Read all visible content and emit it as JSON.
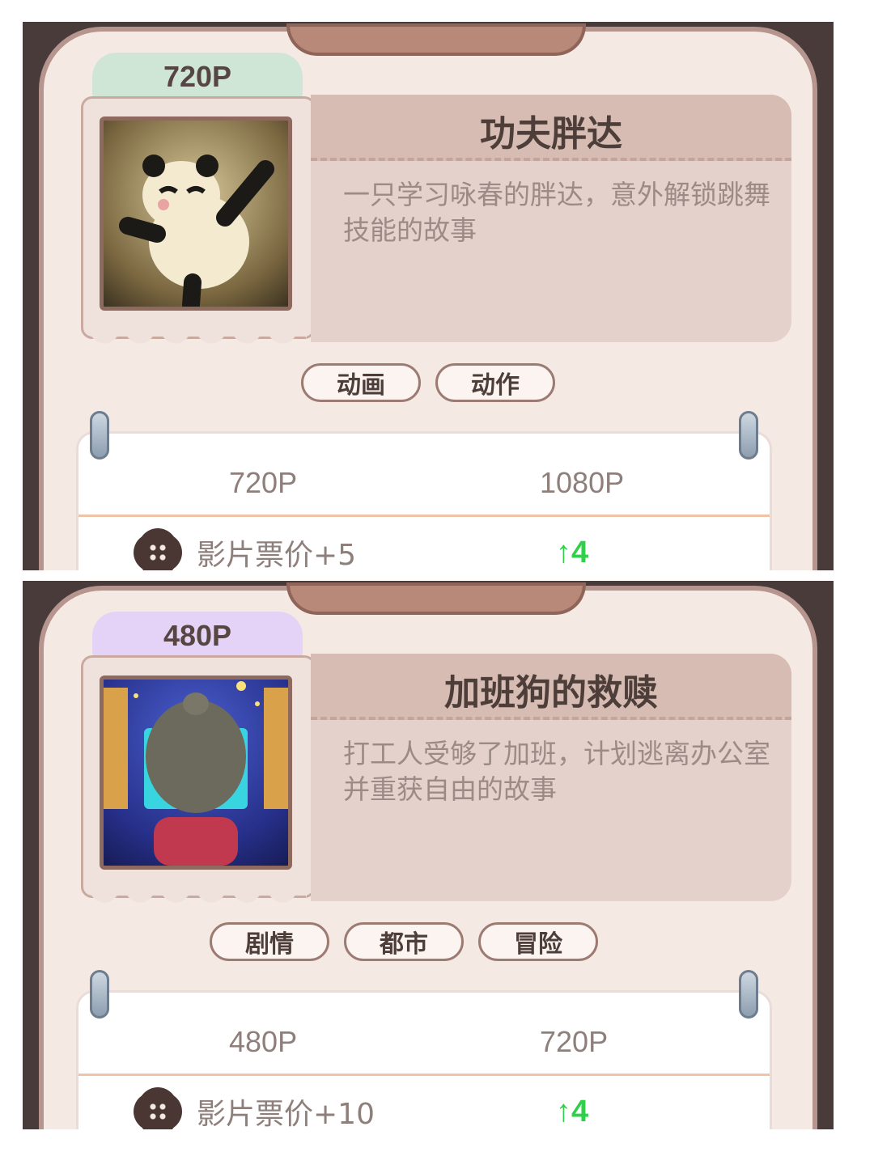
{
  "panels": [
    {
      "quality": "720P",
      "title": "功夫胖达",
      "description": "一只学习咏春的胖达，意外解锁跳舞技能的故事",
      "poster_icon": "panda-poster",
      "tags": [
        "动画",
        "动作"
      ],
      "stats": {
        "from": "720P",
        "to": "1080P",
        "rows": [
          {
            "icon": "ticket-gear-icon",
            "label": "影片票价+5",
            "change": "↑4"
          }
        ]
      }
    },
    {
      "quality": "480P",
      "title": "加班狗的救赎",
      "description": "打工人受够了加班，计划逃离办公室并重获自由的故事",
      "poster_icon": "office-worker-poster",
      "tags": [
        "剧情",
        "都市",
        "冒险"
      ],
      "stats": {
        "from": "480P",
        "to": "720P",
        "rows": [
          {
            "icon": "ticket-gear-icon",
            "label": "影片票价+10",
            "change": "↑4"
          }
        ]
      }
    }
  ]
}
